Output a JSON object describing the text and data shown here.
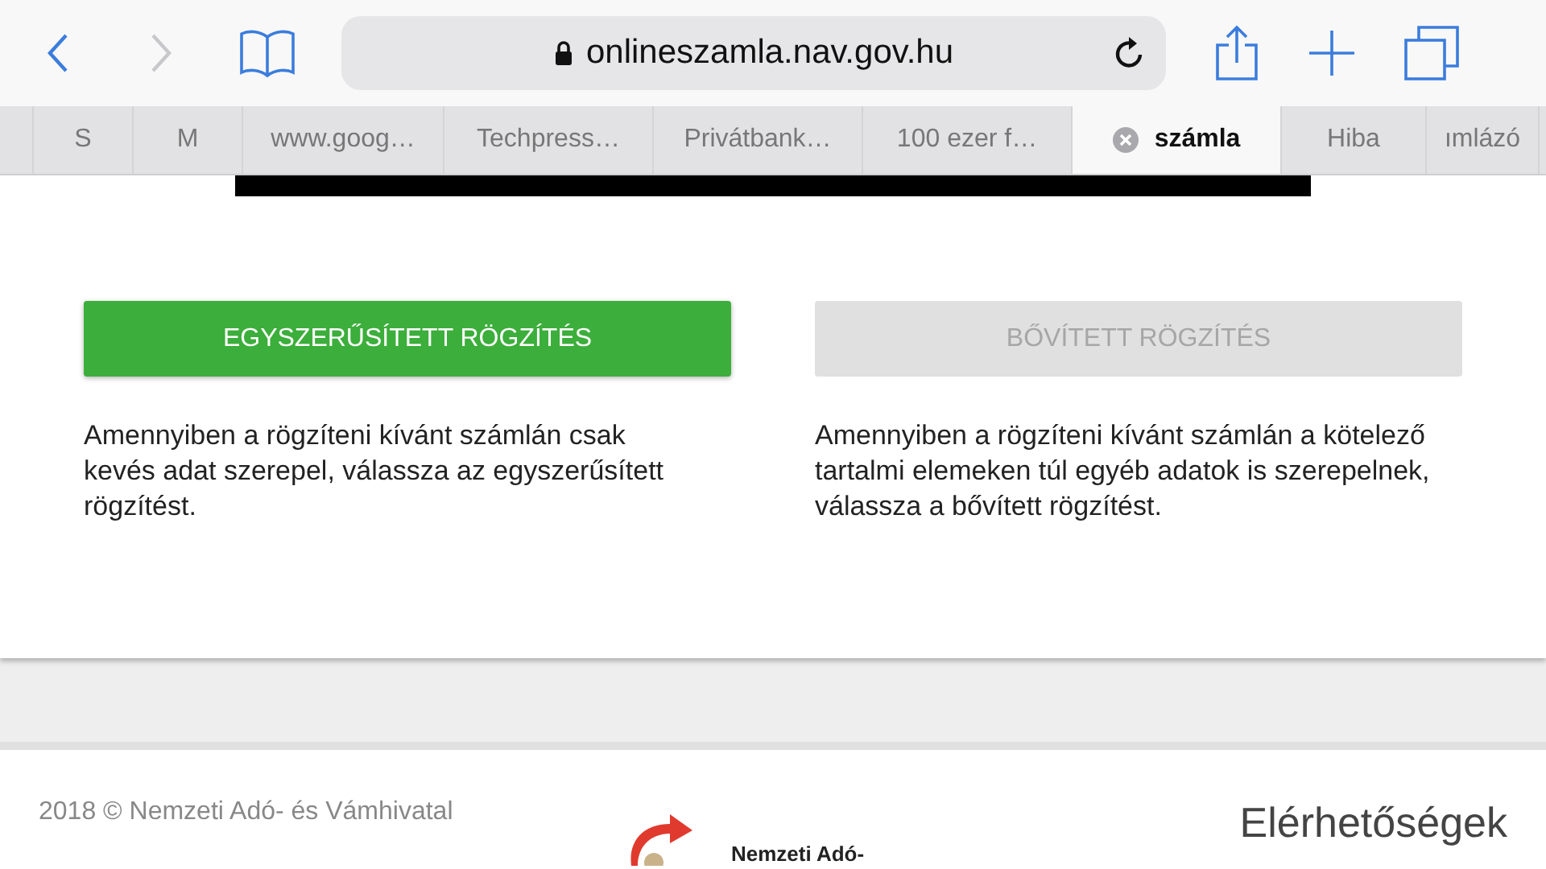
{
  "toolbar": {
    "url": "onlineszamla.nav.gov.hu",
    "back_disabled": false,
    "forward_disabled": true
  },
  "tabs": [
    {
      "label": "S",
      "selected": false,
      "closable": false
    },
    {
      "label": "M",
      "selected": false,
      "closable": false
    },
    {
      "label": "www.goog…",
      "selected": false,
      "closable": false
    },
    {
      "label": "Techpress…",
      "selected": false,
      "closable": false
    },
    {
      "label": "Privátbank…",
      "selected": false,
      "closable": false
    },
    {
      "label": "100 ezer f…",
      "selected": false,
      "closable": false
    },
    {
      "label": "számla",
      "selected": true,
      "closable": true
    },
    {
      "label": "Hiba",
      "selected": false,
      "closable": false
    },
    {
      "label": "ımlázó",
      "selected": false,
      "closable": false
    }
  ],
  "options": [
    {
      "button": "EGYSZERŰSÍTETT RÖGZÍTÉS",
      "disabled": false,
      "description": "Amennyiben a rögzíteni kívánt számlán csak kevés adat szerepel, válassza az egyszerűsített rögzítést."
    },
    {
      "button": "BŐVÍTETT RÖGZÍTÉS",
      "disabled": true,
      "description": "Amennyiben a rögzíteni kívánt számlán a kötelező tartalmi elemeken túl egyéb adatok is szerepelnek, válassza a bővített rögzítést."
    }
  ],
  "footer": {
    "copyright": "2018 © Nemzeti Adó- és Vámhivatal",
    "logo_text": "Nemzeti Adó-",
    "contact_link": "Elérhetőségek"
  }
}
